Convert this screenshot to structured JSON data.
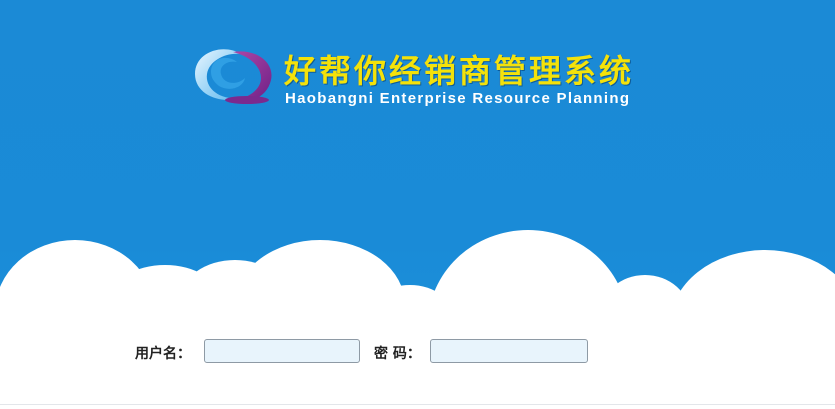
{
  "header": {
    "title": "好帮你经销商管理系统",
    "subtitle": "Haobangni Enterprise Resource Planning",
    "logo_icon": "swirl-logo-icon"
  },
  "login": {
    "username_label": "用户名：",
    "username_value": "",
    "password_label": "密 码：",
    "password_value": ""
  },
  "colors": {
    "sky": "#1a8bd7",
    "title": "#f4e20a",
    "input_bg": "#e8f4fc"
  }
}
